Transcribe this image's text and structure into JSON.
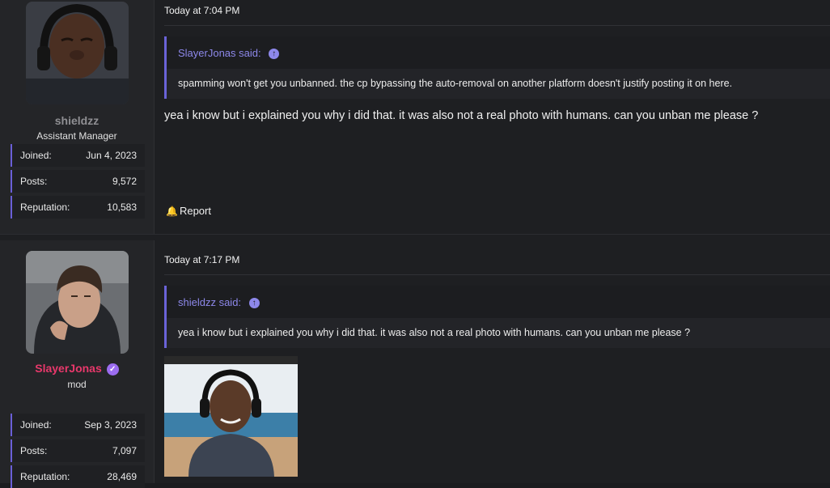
{
  "posts": [
    {
      "author": {
        "name": "shieldzz",
        "role": "Assistant Manager",
        "name_color": "#8f8f93",
        "stats": [
          {
            "label": "Joined:",
            "value": "Jun 4, 2023"
          },
          {
            "label": "Posts:",
            "value": "9,572"
          },
          {
            "label": "Reputation:",
            "value": "10,583"
          }
        ]
      },
      "timestamp": "Today at 7:04 PM",
      "quote": {
        "author_line": "SlayerJonas said:",
        "text": "spamming won't get you unbanned. the cp bypassing the auto-removal on another platform doesn't justify posting it on here."
      },
      "message": "yea i know but i explained you why i did that. it was also not a real photo with humans. can you unban me please ?",
      "report_label": "Report"
    },
    {
      "author": {
        "name": "SlayerJonas",
        "role": "mod",
        "name_color": "#e8386b",
        "stats": [
          {
            "label": "Joined:",
            "value": "Sep 3, 2023"
          },
          {
            "label": "Posts:",
            "value": "7,097"
          },
          {
            "label": "Reputation:",
            "value": "28,469"
          }
        ]
      },
      "timestamp": "Today at 7:17 PM",
      "quote": {
        "author_line": "shieldzz said:",
        "text": "yea i know but i explained you why i did that. it was also not a real photo with humans. can you unban me please ?"
      }
    }
  ],
  "colors": {
    "accent": "#6a63d8",
    "quote_author": "#8d88ea",
    "verified_badge": "#9b6cf0"
  },
  "icons": {
    "quote_jump": "arrow-up-circle-icon",
    "report": "bell-icon",
    "verified": "verified-badge-icon"
  }
}
